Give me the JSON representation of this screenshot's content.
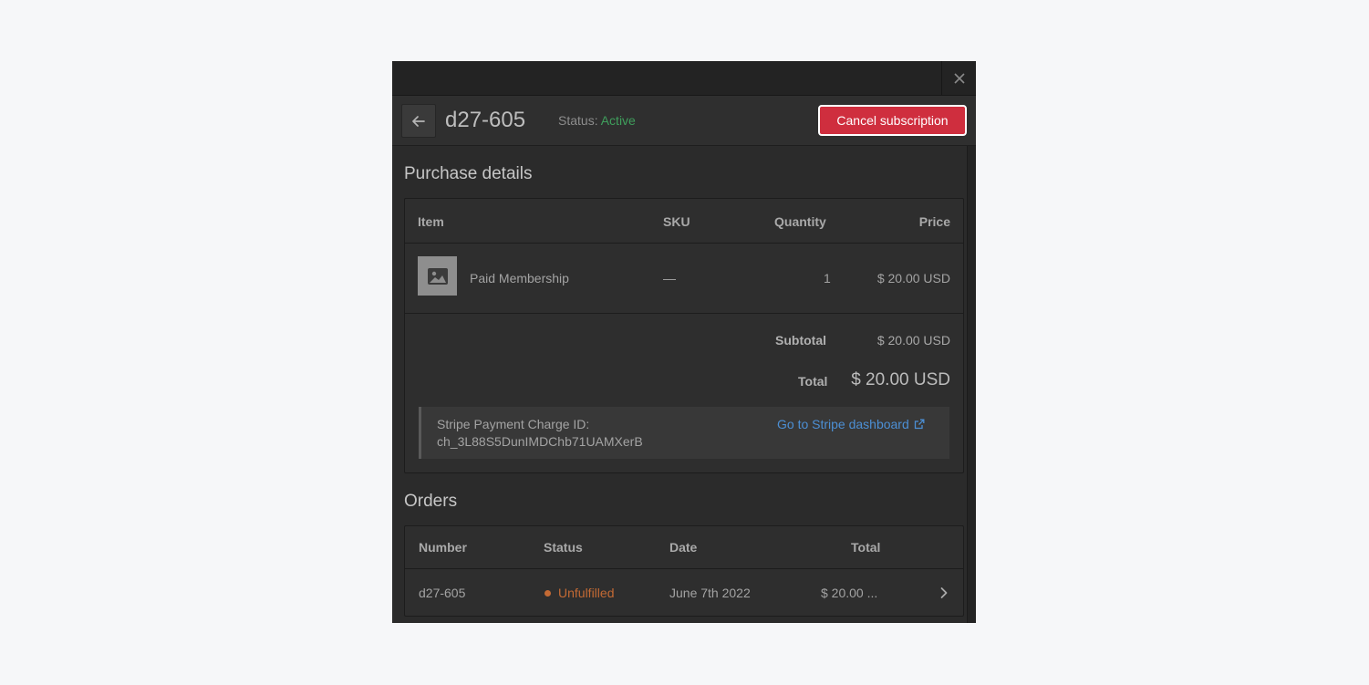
{
  "header": {
    "subscription_id": "d27-605",
    "status_label": "Status:",
    "status_value": "Active",
    "cancel_label": "Cancel subscription"
  },
  "purchase": {
    "title": "Purchase details",
    "columns": [
      "Item",
      "SKU",
      "Quantity",
      "Price"
    ],
    "items": [
      {
        "name": "Paid Membership",
        "sku": "—",
        "quantity": "1",
        "price": "$ 20.00 USD"
      }
    ],
    "subtotal_label": "Subtotal",
    "subtotal_value": "$ 20.00 USD",
    "total_label": "Total",
    "total_value": "$ 20.00 USD",
    "stripe_label": "Stripe Payment Charge ID:",
    "stripe_charge_id": "ch_3L88S5DunIMDChb71UAMXerB",
    "stripe_link": "Go to Stripe dashboard"
  },
  "orders": {
    "title": "Orders",
    "columns": [
      "Number",
      "Status",
      "Date",
      "Total"
    ],
    "rows": [
      {
        "number": "d27-605",
        "status": "Unfulfilled",
        "date": "June 7th 2022",
        "total": "$ 20.00 ..."
      }
    ]
  },
  "colors": {
    "active": "#3f9e5c",
    "cancel": "#cf2e3e",
    "unfulfilled": "#c46a34",
    "link": "#4c8fd4"
  },
  "icons": [
    "close-icon",
    "arrow-left-icon",
    "image-placeholder-icon",
    "external-link-icon",
    "chevron-right-icon"
  ]
}
